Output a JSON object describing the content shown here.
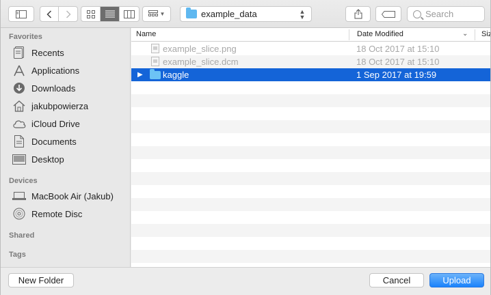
{
  "toolbar": {
    "path_label": "example_data",
    "search_placeholder": "Search",
    "icons": [
      "sidebar-toggle-icon",
      "back-icon",
      "forward-icon",
      "icon-view-icon",
      "list-view-icon",
      "column-view-icon",
      "arrange-icon",
      "share-icon",
      "tag-icon"
    ]
  },
  "sidebar": {
    "favorites_heading": "Favorites",
    "favorites": [
      {
        "label": "Recents",
        "icon": "recents-icon"
      },
      {
        "label": "Applications",
        "icon": "applications-icon"
      },
      {
        "label": "Downloads",
        "icon": "downloads-icon"
      },
      {
        "label": "jakubpowierza",
        "icon": "home-icon"
      },
      {
        "label": "iCloud Drive",
        "icon": "cloud-icon"
      },
      {
        "label": "Documents",
        "icon": "documents-icon"
      },
      {
        "label": "Desktop",
        "icon": "desktop-icon"
      }
    ],
    "devices_heading": "Devices",
    "devices": [
      {
        "label": "MacBook Air (Jakub)",
        "icon": "laptop-icon"
      },
      {
        "label": "Remote Disc",
        "icon": "disc-icon"
      }
    ],
    "shared_heading": "Shared",
    "tags_heading": "Tags"
  },
  "list": {
    "columns": {
      "name": "Name",
      "date": "Date Modified",
      "size": "Siz"
    },
    "rows": [
      {
        "name": "example_slice.png",
        "date": "18 Oct 2017 at 15:10",
        "kind": "file",
        "state": "disabled"
      },
      {
        "name": "example_slice.dcm",
        "date": "18 Oct 2017 at 15:10",
        "kind": "file",
        "state": "disabled"
      },
      {
        "name": "kaggle",
        "date": "1 Sep 2017 at 19:59",
        "kind": "folder",
        "state": "selected"
      }
    ]
  },
  "buttons": {
    "new_folder": "New Folder",
    "cancel": "Cancel",
    "upload": "Upload"
  },
  "colors": {
    "selection": "#1464d8",
    "primary_button": "#1a82fb",
    "folder": "#6cc3f5"
  }
}
